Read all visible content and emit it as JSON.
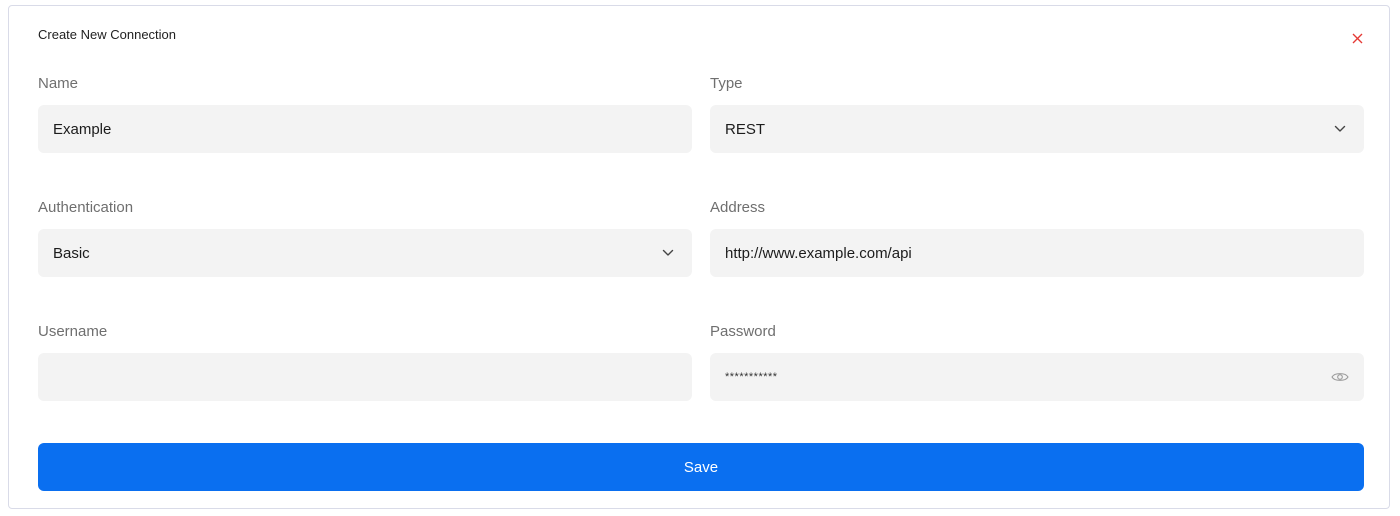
{
  "dialog": {
    "title": "Create New Connection",
    "close_icon": "close-icon",
    "close_color": "#e53935"
  },
  "form": {
    "name": {
      "label": "Name",
      "value": "Example"
    },
    "type": {
      "label": "Type",
      "value": "REST",
      "icon": "chevron-down-icon"
    },
    "authentication": {
      "label": "Authentication",
      "value": "Basic",
      "icon": "chevron-down-icon"
    },
    "address": {
      "label": "Address",
      "value": "http://www.example.com/api"
    },
    "username": {
      "label": "Username",
      "value": ""
    },
    "password": {
      "label": "Password",
      "value": "***********",
      "icon": "eye-icon"
    }
  },
  "actions": {
    "save_label": "Save",
    "accent": "#0a6ff0"
  }
}
